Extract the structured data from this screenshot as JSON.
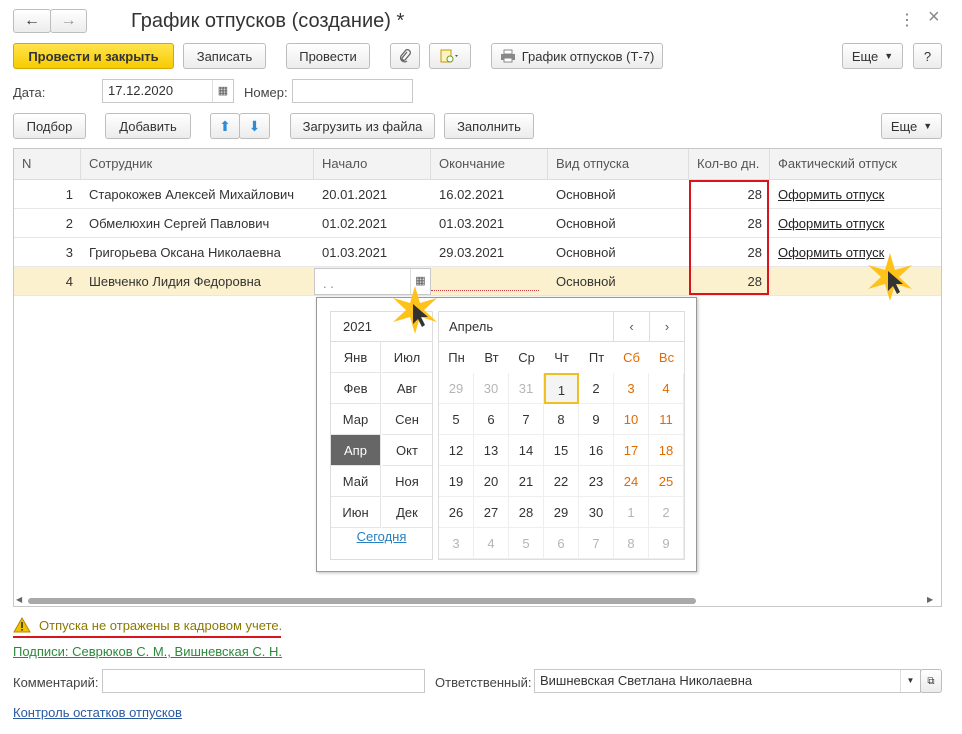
{
  "window": {
    "title": "График отпусков (создание) *",
    "back_icon": "←",
    "forward_icon": "→",
    "more_icon": "⋮",
    "close_icon": "×"
  },
  "toolbar": {
    "post_close": "Провести и закрыть",
    "save": "Записать",
    "post": "Провести",
    "print": "График отпусков (Т-7)",
    "more": "Еще",
    "help": "?"
  },
  "header": {
    "date_label": "Дата:",
    "date_value": "17.12.2020",
    "number_label": "Номер:",
    "number_value": ""
  },
  "table_toolbar": {
    "select": "Подбор",
    "add": "Добавить",
    "load": "Загрузить из файла",
    "fill": "Заполнить",
    "more": "Еще"
  },
  "table": {
    "columns": [
      "N",
      "Сотрудник",
      "Начало",
      "Окончание",
      "Вид отпуска",
      "Кол-во дн.",
      "Фактический отпуск"
    ],
    "rows": [
      {
        "n": "1",
        "employee": "Старокожев Алексей Михайлович",
        "start": "20.01.2021",
        "end": "16.02.2021",
        "type": "Основной",
        "days": "28",
        "actual": "Оформить отпуск"
      },
      {
        "n": "2",
        "employee": "Обмелюхин Сергей Павлович",
        "start": "01.02.2021",
        "end": "01.03.2021",
        "type": "Основной",
        "days": "28",
        "actual": "Оформить отпуск"
      },
      {
        "n": "3",
        "employee": "Григорьева Оксана Николаевна",
        "start": "01.03.2021",
        "end": "29.03.2021",
        "type": "Основной",
        "days": "28",
        "actual": "Оформить отпуск"
      },
      {
        "n": "4",
        "employee": "Шевченко Лидия Федоровна",
        "start": "  .  .",
        "end": "",
        "type": "Основной",
        "days": "28",
        "actual": ""
      }
    ]
  },
  "calendar": {
    "year": "2021",
    "month": "Апрель",
    "months": [
      [
        "Янв",
        "Июл"
      ],
      [
        "Фев",
        "Авг"
      ],
      [
        "Мар",
        "Сен"
      ],
      [
        "Апр",
        "Окт"
      ],
      [
        "Май",
        "Ноя"
      ],
      [
        "Июн",
        "Дек"
      ]
    ],
    "today": "Сегодня",
    "weekdays": [
      "Пн",
      "Вт",
      "Ср",
      "Чт",
      "Пт",
      "Сб",
      "Вс"
    ],
    "weeks": [
      [
        "29",
        "30",
        "31",
        "1",
        "2",
        "3",
        "4"
      ],
      [
        "5",
        "6",
        "7",
        "8",
        "9",
        "10",
        "11"
      ],
      [
        "12",
        "13",
        "14",
        "15",
        "16",
        "17",
        "18"
      ],
      [
        "19",
        "20",
        "21",
        "22",
        "23",
        "24",
        "25"
      ],
      [
        "26",
        "27",
        "28",
        "29",
        "30",
        "1",
        "2"
      ],
      [
        "3",
        "4",
        "5",
        "6",
        "7",
        "8",
        "9"
      ]
    ]
  },
  "footer": {
    "warning": "Отпуска не отражены в кадровом учете.",
    "signatures": "Подписи: Севрюков С. М., Вишневская С. Н.",
    "comment_label": "Комментарий:",
    "comment_value": "",
    "responsible_label": "Ответственный:",
    "responsible_value": "Вишневская Светлана Николаевна",
    "control_link": "Контроль остатков отпусков"
  }
}
